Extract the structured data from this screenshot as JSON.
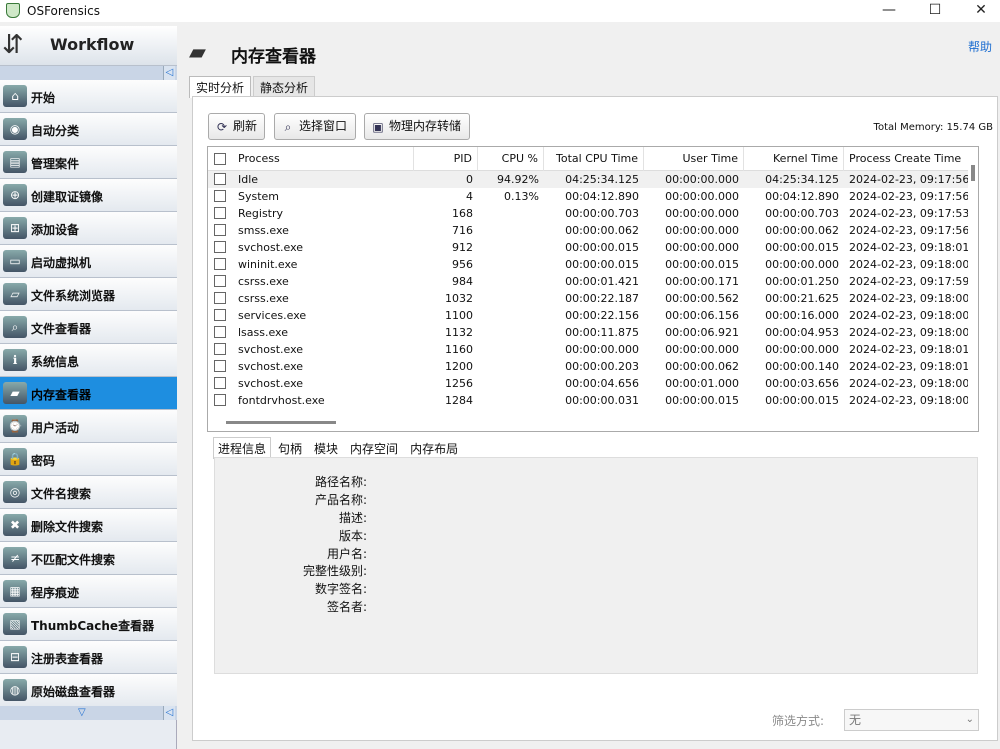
{
  "window": {
    "title": "OSForensics",
    "minimize": "—",
    "maximize": "☐",
    "close": "✕"
  },
  "sidebar": {
    "header": "Workflow",
    "scroll_up": "◁",
    "scroll_down": "▽",
    "items": [
      {
        "label": "开始",
        "icon": "home-icon"
      },
      {
        "label": "自动分类",
        "icon": "fingerprint-icon"
      },
      {
        "label": "管理案件",
        "icon": "briefcase-icon"
      },
      {
        "label": "创建取证镜像",
        "icon": "drive-add-icon"
      },
      {
        "label": "添加设备",
        "icon": "add-device-icon"
      },
      {
        "label": "启动虚拟机",
        "icon": "virtual-machine-icon"
      },
      {
        "label": "文件系统浏览器",
        "icon": "folder-search-icon"
      },
      {
        "label": "文件查看器",
        "icon": "file-viewer-icon"
      },
      {
        "label": "系统信息",
        "icon": "system-info-icon"
      },
      {
        "label": "内存查看器",
        "icon": "memory-icon"
      },
      {
        "label": "用户活动",
        "icon": "user-activity-icon"
      },
      {
        "label": "密码",
        "icon": "password-icon"
      },
      {
        "label": "文件名搜索",
        "icon": "binoculars-icon"
      },
      {
        "label": "删除文件搜索",
        "icon": "deleted-file-icon"
      },
      {
        "label": "不匹配文件搜索",
        "icon": "mismatch-file-icon"
      },
      {
        "label": "程序痕迹",
        "icon": "program-artifacts-icon"
      },
      {
        "label": "ThumbCache查看器",
        "icon": "thumbcache-icon"
      },
      {
        "label": "注册表查看器",
        "icon": "registry-icon"
      },
      {
        "label": "原始磁盘查看器",
        "icon": "raw-disk-icon"
      }
    ],
    "active_index": 9
  },
  "page": {
    "title": "内存查看器",
    "help": "帮助",
    "tabs": [
      "实时分析",
      "静态分析"
    ],
    "toolbar": {
      "refresh": "刷新",
      "select_window": "选择窗口",
      "dump": "物理内存转储"
    },
    "total_memory": "Total Memory: 15.74 GB",
    "columns": [
      "Process",
      "PID",
      "CPU %",
      "Total CPU Time",
      "User Time",
      "Kernel Time",
      "Process Create Time"
    ],
    "processes": [
      [
        "Idle",
        "0",
        "94.92%",
        "04:25:34.125",
        "00:00:00.000",
        "04:25:34.125",
        "2024-02-23, 09:17:56"
      ],
      [
        "System",
        "4",
        "0.13%",
        "00:04:12.890",
        "00:00:00.000",
        "00:04:12.890",
        "2024-02-23, 09:17:56"
      ],
      [
        "Registry",
        "168",
        "",
        "00:00:00.703",
        "00:00:00.000",
        "00:00:00.703",
        "2024-02-23, 09:17:53"
      ],
      [
        "smss.exe",
        "716",
        "",
        "00:00:00.062",
        "00:00:00.000",
        "00:00:00.062",
        "2024-02-23, 09:17:56"
      ],
      [
        "svchost.exe",
        "912",
        "",
        "00:00:00.015",
        "00:00:00.000",
        "00:00:00.015",
        "2024-02-23, 09:18:01"
      ],
      [
        "wininit.exe",
        "956",
        "",
        "00:00:00.015",
        "00:00:00.015",
        "00:00:00.000",
        "2024-02-23, 09:18:00"
      ],
      [
        "csrss.exe",
        "984",
        "",
        "00:00:01.421",
        "00:00:00.171",
        "00:00:01.250",
        "2024-02-23, 09:17:59"
      ],
      [
        "csrss.exe",
        "1032",
        "",
        "00:00:22.187",
        "00:00:00.562",
        "00:00:21.625",
        "2024-02-23, 09:18:00"
      ],
      [
        "services.exe",
        "1100",
        "",
        "00:00:22.156",
        "00:00:06.156",
        "00:00:16.000",
        "2024-02-23, 09:18:00"
      ],
      [
        "lsass.exe",
        "1132",
        "",
        "00:00:11.875",
        "00:00:06.921",
        "00:00:04.953",
        "2024-02-23, 09:18:00"
      ],
      [
        "svchost.exe",
        "1160",
        "",
        "00:00:00.000",
        "00:00:00.000",
        "00:00:00.000",
        "2024-02-23, 09:18:01"
      ],
      [
        "svchost.exe",
        "1200",
        "",
        "00:00:00.203",
        "00:00:00.062",
        "00:00:00.140",
        "2024-02-23, 09:18:01"
      ],
      [
        "svchost.exe",
        "1256",
        "",
        "00:00:04.656",
        "00:00:01.000",
        "00:00:03.656",
        "2024-02-23, 09:18:00"
      ],
      [
        "fontdrvhost.exe",
        "1284",
        "",
        "00:00:00.031",
        "00:00:00.015",
        "00:00:00.015",
        "2024-02-23, 09:18:00"
      ]
    ],
    "detail_tabs": [
      "进程信息",
      "句柄",
      "模块",
      "内存空间",
      "内存布局"
    ],
    "detail_fields": [
      "路径名称:",
      "产品名称:",
      "描述:",
      "版本:",
      "用户名:",
      "完整性级别:",
      "数字签名:",
      "签名者:"
    ],
    "filter_label": "筛选方式:",
    "filter_value": "无"
  }
}
